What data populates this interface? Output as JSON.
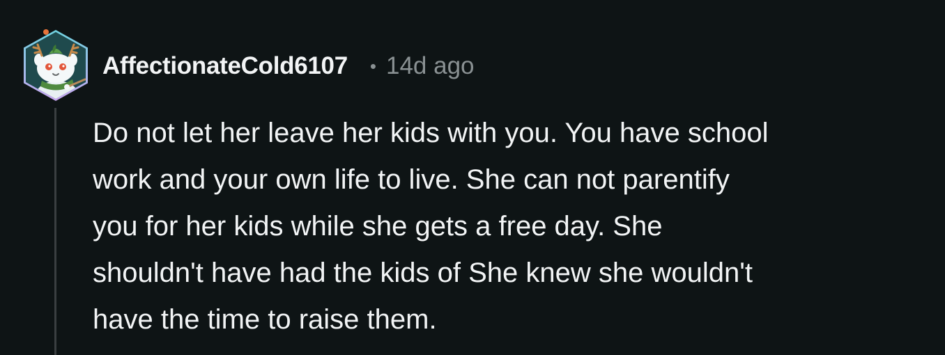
{
  "comment": {
    "author": "AffectionateCold6107",
    "separator": "•",
    "timestamp": "14d ago",
    "avatar_icon": "snoo-avatar-icon",
    "body_lines": [
      "Do not let her leave her kids with you. You have school",
      "work and your own life to live. She can not parentify",
      "you for her kids while she gets a free day. She",
      "shouldn't have had the kids of She knew she wouldn't",
      "have the time to raise them."
    ]
  },
  "colors": {
    "background": "#0e1415",
    "text_primary": "#f2f4f5",
    "text_secondary": "#8a9193",
    "thread_line": "#3a3f41",
    "avatar_border_top": "#6fd3e0",
    "avatar_border_bottom": "#c9a7f0"
  }
}
